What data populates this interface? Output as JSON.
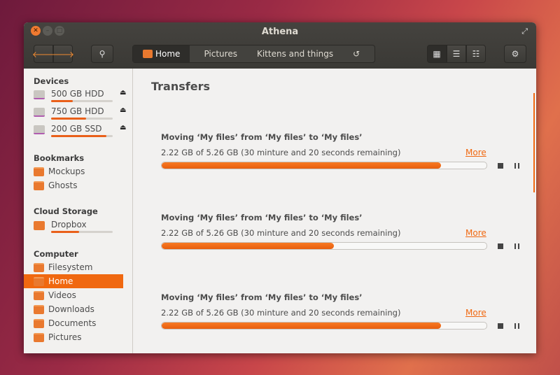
{
  "window": {
    "title": "Athena"
  },
  "toolbar": {
    "breadcrumbs": [
      "Home",
      "Pictures",
      "Kittens and things"
    ]
  },
  "sidebar": {
    "devices_header": "Devices",
    "devices": [
      {
        "label": "500 GB HDD",
        "usage": 0.35
      },
      {
        "label": "750 GB HDD",
        "usage": 0.57
      },
      {
        "label": "200 GB SSD",
        "usage": 0.9
      }
    ],
    "bookmarks_header": "Bookmarks",
    "bookmarks": [
      "Mockups",
      "Ghosts"
    ],
    "cloud_header": "Cloud Storage",
    "cloud": {
      "label": "Dropbox",
      "usage": 0.45
    },
    "computer_header": "Computer",
    "computer": [
      "Filesystem",
      "Home",
      "Videos",
      "Downloads",
      "Documents",
      "Pictures"
    ],
    "selected": "Home"
  },
  "main": {
    "title": "Transfers",
    "transfers": [
      {
        "title": "Moving ‘My files’ from ‘My files’ to ‘My files’",
        "status": "2.22 GB of 5.26 GB (30 minture and 20 seconds remaining)",
        "more": "More",
        "progress": 0.86
      },
      {
        "title": "Moving ‘My files’ from ‘My files’ to ‘My files’",
        "status": "2.22 GB of 5.26 GB (30 minture and 20 seconds remaining)",
        "more": "More",
        "progress": 0.53
      },
      {
        "title": "Moving ‘My files’ from ‘My files’ to ‘My files’",
        "status": "2.22 GB of 5.26 GB (30 minture and 20 seconds remaining)",
        "more": "More",
        "progress": 0.86
      }
    ]
  },
  "colors": {
    "accent": "#f06810",
    "toolbar": "#3c3b37"
  }
}
